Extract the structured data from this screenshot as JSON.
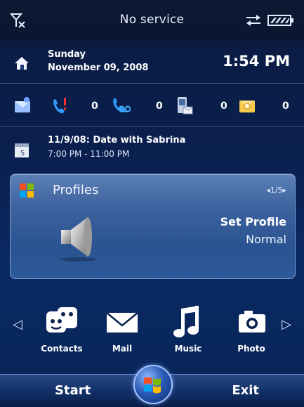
{
  "status": {
    "service_text": "No service"
  },
  "today": {
    "day": "Sunday",
    "date": "November 09, 2008",
    "time": "1:54 PM"
  },
  "notifications": [
    {
      "icon": "missed-call-icon",
      "count": "0"
    },
    {
      "icon": "voicemail-icon",
      "count": "0"
    },
    {
      "icon": "text-message-icon",
      "count": "0"
    },
    {
      "icon": "email-icon",
      "count": "0"
    }
  ],
  "appointment": {
    "title": "11/9/08: Date with Sabrina",
    "time": "7:00 PM - 11:00 PM"
  },
  "profiles": {
    "title": "Profiles",
    "pager": "◂1/5▸",
    "label": "Set Profile",
    "value": "Normal"
  },
  "apps": [
    {
      "label": "Contacts",
      "icon": "contacts-icon"
    },
    {
      "label": "Mail",
      "icon": "mail-icon"
    },
    {
      "label": "Music",
      "icon": "music-icon"
    },
    {
      "label": "Photo",
      "icon": "camera-icon"
    }
  ],
  "softkeys": {
    "left": "Start",
    "right": "Exit"
  },
  "colors": {
    "background": "#0a2050",
    "panel": "#3f649f",
    "accent": "#a8c4ff"
  }
}
